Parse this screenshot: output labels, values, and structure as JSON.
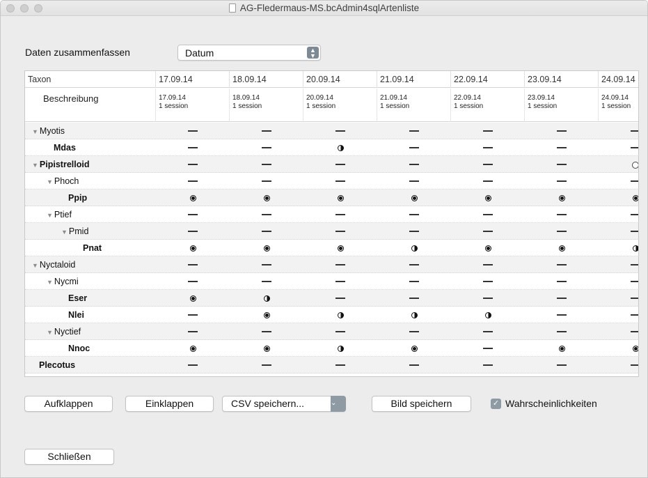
{
  "window": {
    "title": "AG-Fledermaus-MS.bcAdmin4sqlArtenliste"
  },
  "summary": {
    "label": "Daten zusammenfassen",
    "selected": "Datum"
  },
  "table": {
    "taxon_header": "Taxon",
    "desc_label": "Beschreibung",
    "dates": [
      "17.09.14",
      "18.09.14",
      "20.09.14",
      "21.09.14",
      "22.09.14",
      "23.09.14",
      "24.09.14"
    ],
    "descriptions": [
      {
        "date": "17.09.14",
        "session": "1 session"
      },
      {
        "date": "18.09.14",
        "session": "1 session"
      },
      {
        "date": "20.09.14",
        "session": "1 session"
      },
      {
        "date": "21.09.14",
        "session": "1 session"
      },
      {
        "date": "22.09.14",
        "session": "1 session"
      },
      {
        "date": "23.09.14",
        "session": "1 session"
      },
      {
        "date": "24.09.14",
        "session": "1 session"
      }
    ],
    "rows": [
      {
        "name": "Myotis",
        "level": 0,
        "group": true,
        "bold": false,
        "values": [
          "dash",
          "dash",
          "dash",
          "dash",
          "dash",
          "dash",
          "dash"
        ]
      },
      {
        "name": "Mdas",
        "level": 1,
        "group": false,
        "bold": true,
        "values": [
          "dash",
          "dash",
          "half",
          "dash",
          "dash",
          "dash",
          "dash"
        ]
      },
      {
        "name": "Pipistrelloid",
        "level": 0,
        "group": true,
        "bold": true,
        "values": [
          "dash",
          "dash",
          "dash",
          "dash",
          "dash",
          "dash",
          "empty"
        ]
      },
      {
        "name": "Phoch",
        "level": 1,
        "group": true,
        "bold": false,
        "values": [
          "dash",
          "dash",
          "dash",
          "dash",
          "dash",
          "dash",
          "dash"
        ]
      },
      {
        "name": "Ppip",
        "level": 2,
        "group": false,
        "bold": true,
        "values": [
          "full",
          "full",
          "full",
          "full",
          "full",
          "full",
          "full"
        ]
      },
      {
        "name": "Ptief",
        "level": 1,
        "group": true,
        "bold": false,
        "values": [
          "dash",
          "dash",
          "dash",
          "dash",
          "dash",
          "dash",
          "dash"
        ]
      },
      {
        "name": "Pmid",
        "level": 2,
        "group": true,
        "bold": false,
        "values": [
          "dash",
          "dash",
          "dash",
          "dash",
          "dash",
          "dash",
          "dash"
        ]
      },
      {
        "name": "Pnat",
        "level": 3,
        "group": false,
        "bold": true,
        "values": [
          "full",
          "full",
          "full",
          "half",
          "full",
          "full",
          "half"
        ]
      },
      {
        "name": "Nyctaloid",
        "level": 0,
        "group": true,
        "bold": false,
        "values": [
          "dash",
          "dash",
          "dash",
          "dash",
          "dash",
          "dash",
          "dash"
        ]
      },
      {
        "name": "Nycmi",
        "level": 1,
        "group": true,
        "bold": false,
        "values": [
          "dash",
          "dash",
          "dash",
          "dash",
          "dash",
          "dash",
          "dash"
        ]
      },
      {
        "name": "Eser",
        "level": 2,
        "group": false,
        "bold": true,
        "values": [
          "full",
          "half",
          "dash",
          "dash",
          "dash",
          "dash",
          "dash"
        ]
      },
      {
        "name": "Nlei",
        "level": 2,
        "group": false,
        "bold": true,
        "values": [
          "dash",
          "full",
          "half",
          "half",
          "half",
          "dash",
          "dash"
        ]
      },
      {
        "name": "Nyctief",
        "level": 1,
        "group": true,
        "bold": false,
        "values": [
          "dash",
          "dash",
          "dash",
          "dash",
          "dash",
          "dash",
          "dash"
        ]
      },
      {
        "name": "Nnoc",
        "level": 2,
        "group": false,
        "bold": true,
        "values": [
          "full",
          "full",
          "half",
          "full",
          "dash",
          "full",
          "full"
        ]
      },
      {
        "name": "Plecotus",
        "level": 0,
        "group": false,
        "bold": true,
        "values": [
          "dash",
          "dash",
          "dash",
          "dash",
          "dash",
          "dash",
          "dash"
        ]
      }
    ]
  },
  "buttons": {
    "expand": "Aufklappen",
    "collapse": "Einklappen",
    "csv": "CSV speichern...",
    "save_image": "Bild speichern",
    "probabilities": "Wahrscheinlichkeiten",
    "close": "Schließen"
  },
  "icons": {
    "dropdown": "updown-chevron-icon",
    "csv_arrow": "chevron-down-icon",
    "checkbox": "checkmark-icon"
  }
}
